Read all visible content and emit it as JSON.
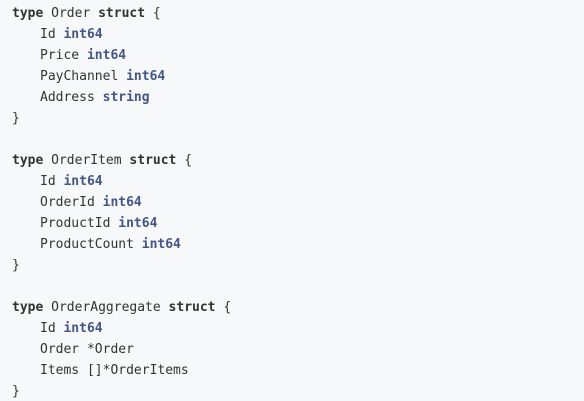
{
  "code": {
    "keywords": {
      "type": "type",
      "struct": "struct"
    },
    "structs": [
      {
        "name": "Order",
        "open": "{",
        "close": "}",
        "fields": [
          {
            "name": "Id",
            "type": "int64"
          },
          {
            "name": "Price",
            "type": "int64"
          },
          {
            "name": "PayChannel",
            "type": "int64"
          },
          {
            "name": "Address",
            "type": "string"
          }
        ]
      },
      {
        "name": "OrderItem",
        "open": "{",
        "close": "}",
        "fields": [
          {
            "name": "Id",
            "type": "int64"
          },
          {
            "name": "OrderId",
            "type": "int64"
          },
          {
            "name": "ProductId",
            "type": "int64"
          },
          {
            "name": "ProductCount",
            "type": "int64"
          }
        ]
      },
      {
        "name": "OrderAggregate",
        "open": "{",
        "close": "}",
        "fields": [
          {
            "name": "Id",
            "type": "int64"
          },
          {
            "name": "Order",
            "type": "*Order"
          },
          {
            "name": "Items",
            "type": "[]*OrderItems"
          }
        ]
      }
    ]
  },
  "colors": {
    "background": "#f6f8fa",
    "text": "#333333",
    "builtin_type": "#445588"
  }
}
